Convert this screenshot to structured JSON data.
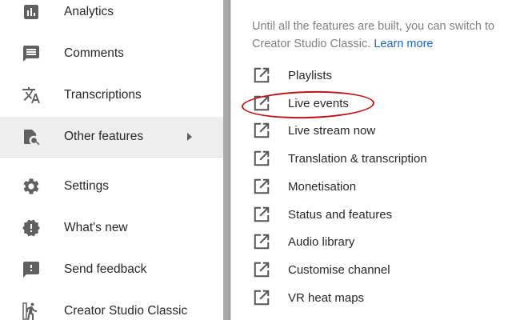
{
  "sidebar": {
    "items": [
      {
        "label": "Analytics",
        "icon": "analytics-icon"
      },
      {
        "label": "Comments",
        "icon": "comments-icon"
      },
      {
        "label": "Transcriptions",
        "icon": "translate-icon"
      },
      {
        "label": "Other features",
        "icon": "other-features-icon",
        "active": true
      },
      {
        "label": "Settings",
        "icon": "gear-icon"
      },
      {
        "label": "What's new",
        "icon": "whats-new-icon"
      },
      {
        "label": "Send feedback",
        "icon": "feedback-icon"
      },
      {
        "label": "Creator Studio Classic",
        "icon": "exit-icon"
      }
    ]
  },
  "popup": {
    "intro_text": "Until all the features are built, you can switch to Creator Studio Classic.",
    "learn_more": "Learn more",
    "items": [
      {
        "label": "Playlists"
      },
      {
        "label": "Live events",
        "highlighted": true
      },
      {
        "label": "Live stream now"
      },
      {
        "label": "Translation & transcription"
      },
      {
        "label": "Monetisation"
      },
      {
        "label": "Status and features"
      },
      {
        "label": "Audio library"
      },
      {
        "label": "Customise channel"
      },
      {
        "label": "VR heat maps"
      }
    ]
  },
  "colors": {
    "link": "#1a66c9",
    "highlight_ring": "#c0141c",
    "active_bg": "#eeeeee",
    "icon_gray": "#606060"
  }
}
